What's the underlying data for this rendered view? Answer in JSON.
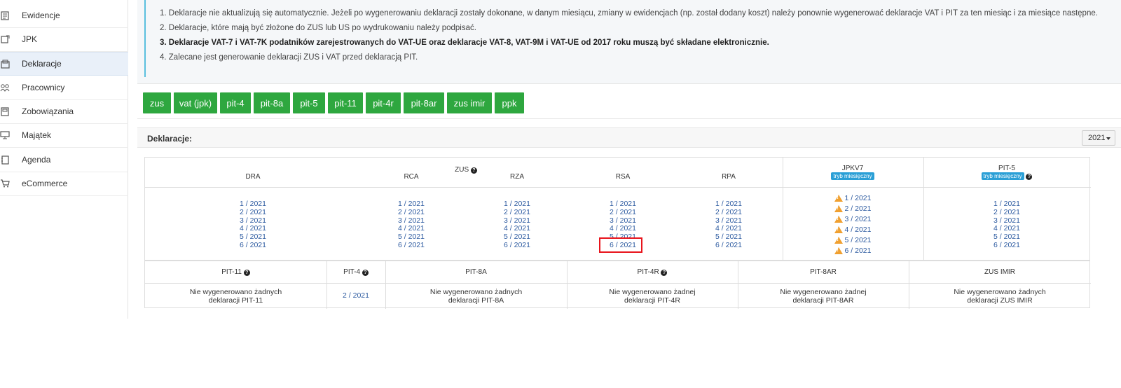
{
  "sidebar": {
    "items": [
      {
        "label": "Ewidencje",
        "icon": "ledger-icon"
      },
      {
        "label": "JPK",
        "icon": "jpk-icon"
      },
      {
        "label": "Deklaracje",
        "icon": "declarations-icon"
      },
      {
        "label": "Pracownicy",
        "icon": "employees-icon"
      },
      {
        "label": "Zobowiązania",
        "icon": "liabilities-icon"
      },
      {
        "label": "Majątek",
        "icon": "assets-icon"
      },
      {
        "label": "Agenda",
        "icon": "agenda-icon"
      },
      {
        "label": "eCommerce",
        "icon": "cart-icon"
      }
    ]
  },
  "notes": [
    "1. Deklaracje nie aktualizują się automatycznie. Jeżeli po wygenerowaniu deklaracji zostały dokonane, w danym miesiącu, zmiany w ewidencjach (np. został dodany koszt) należy ponownie wygenerować deklaracje VAT i PIT za ten miesiąc i za miesiące następne.",
    "2. Deklaracje, które mają być złożone do ZUS lub US po wydrukowaniu należy podpisać.",
    "3. Deklaracje VAT-7 i VAT-7K podatników zarejestrowanych do VAT-UE oraz deklaracje VAT-8, VAT-9M i VAT-UE od 2017 roku muszą być składane elektronicznie.",
    "4. Zalecane jest generowanie deklaracji ZUS i VAT przed deklaracją PIT."
  ],
  "buttons": [
    "zus",
    "vat (jpk)",
    "pit-4",
    "pit-8a",
    "pit-5",
    "pit-11",
    "pit-4r",
    "pit-8ar",
    "zus imir",
    "ppk"
  ],
  "panel": {
    "title": "Deklaracje:",
    "year": "2021"
  },
  "table1": {
    "zus_group": "ZUS",
    "jpk_group": "JPKV7",
    "pit5_group": "PIT-5",
    "mode_badge": "tryb miesięczny",
    "columns": [
      "DRA",
      "RCA",
      "RZA",
      "RSA",
      "RPA"
    ],
    "months": [
      "1 / 2021",
      "2 / 2021",
      "3 / 2021",
      "4 / 2021",
      "5 / 2021",
      "6 / 2021"
    ]
  },
  "table2": {
    "headers": [
      "PIT-11",
      "PIT-4",
      "PIT-8A",
      "PIT-4R",
      "PIT-8AR",
      "ZUS IMIR"
    ],
    "cells": [
      "Nie wygenerowano żadnych\ndeklaracji PIT-11",
      "2 / 2021",
      "Nie wygenerowano żadnych\ndeklaracji PIT-8A",
      "Nie wygenerowano żadnej\ndeklaracji PIT-4R",
      "Nie wygenerowano żadnej\ndeklaracji PIT-8AR",
      "Nie wygenerowano żadnych\ndeklaracji ZUS IMIR"
    ]
  }
}
